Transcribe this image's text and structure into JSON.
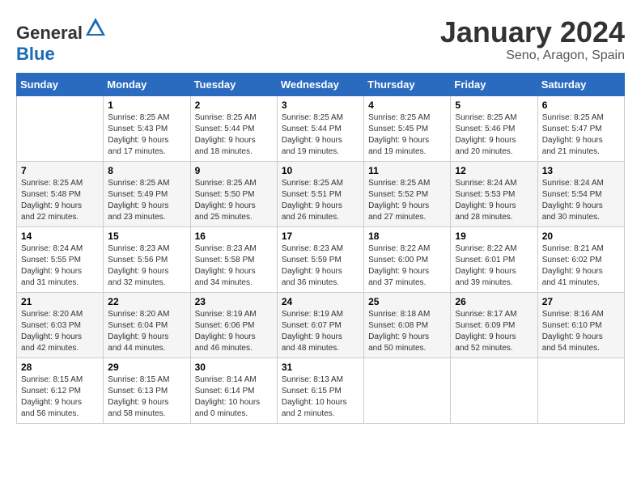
{
  "header": {
    "logo_general": "General",
    "logo_blue": "Blue",
    "title": "January 2024",
    "subtitle": "Seno, Aragon, Spain"
  },
  "weekdays": [
    "Sunday",
    "Monday",
    "Tuesday",
    "Wednesday",
    "Thursday",
    "Friday",
    "Saturday"
  ],
  "weeks": [
    [
      {
        "day": "",
        "info": ""
      },
      {
        "day": "1",
        "info": "Sunrise: 8:25 AM\nSunset: 5:43 PM\nDaylight: 9 hours\nand 17 minutes."
      },
      {
        "day": "2",
        "info": "Sunrise: 8:25 AM\nSunset: 5:44 PM\nDaylight: 9 hours\nand 18 minutes."
      },
      {
        "day": "3",
        "info": "Sunrise: 8:25 AM\nSunset: 5:44 PM\nDaylight: 9 hours\nand 19 minutes."
      },
      {
        "day": "4",
        "info": "Sunrise: 8:25 AM\nSunset: 5:45 PM\nDaylight: 9 hours\nand 19 minutes."
      },
      {
        "day": "5",
        "info": "Sunrise: 8:25 AM\nSunset: 5:46 PM\nDaylight: 9 hours\nand 20 minutes."
      },
      {
        "day": "6",
        "info": "Sunrise: 8:25 AM\nSunset: 5:47 PM\nDaylight: 9 hours\nand 21 minutes."
      }
    ],
    [
      {
        "day": "7",
        "info": "Sunrise: 8:25 AM\nSunset: 5:48 PM\nDaylight: 9 hours\nand 22 minutes."
      },
      {
        "day": "8",
        "info": "Sunrise: 8:25 AM\nSunset: 5:49 PM\nDaylight: 9 hours\nand 23 minutes."
      },
      {
        "day": "9",
        "info": "Sunrise: 8:25 AM\nSunset: 5:50 PM\nDaylight: 9 hours\nand 25 minutes."
      },
      {
        "day": "10",
        "info": "Sunrise: 8:25 AM\nSunset: 5:51 PM\nDaylight: 9 hours\nand 26 minutes."
      },
      {
        "day": "11",
        "info": "Sunrise: 8:25 AM\nSunset: 5:52 PM\nDaylight: 9 hours\nand 27 minutes."
      },
      {
        "day": "12",
        "info": "Sunrise: 8:24 AM\nSunset: 5:53 PM\nDaylight: 9 hours\nand 28 minutes."
      },
      {
        "day": "13",
        "info": "Sunrise: 8:24 AM\nSunset: 5:54 PM\nDaylight: 9 hours\nand 30 minutes."
      }
    ],
    [
      {
        "day": "14",
        "info": "Sunrise: 8:24 AM\nSunset: 5:55 PM\nDaylight: 9 hours\nand 31 minutes."
      },
      {
        "day": "15",
        "info": "Sunrise: 8:23 AM\nSunset: 5:56 PM\nDaylight: 9 hours\nand 32 minutes."
      },
      {
        "day": "16",
        "info": "Sunrise: 8:23 AM\nSunset: 5:58 PM\nDaylight: 9 hours\nand 34 minutes."
      },
      {
        "day": "17",
        "info": "Sunrise: 8:23 AM\nSunset: 5:59 PM\nDaylight: 9 hours\nand 36 minutes."
      },
      {
        "day": "18",
        "info": "Sunrise: 8:22 AM\nSunset: 6:00 PM\nDaylight: 9 hours\nand 37 minutes."
      },
      {
        "day": "19",
        "info": "Sunrise: 8:22 AM\nSunset: 6:01 PM\nDaylight: 9 hours\nand 39 minutes."
      },
      {
        "day": "20",
        "info": "Sunrise: 8:21 AM\nSunset: 6:02 PM\nDaylight: 9 hours\nand 41 minutes."
      }
    ],
    [
      {
        "day": "21",
        "info": "Sunrise: 8:20 AM\nSunset: 6:03 PM\nDaylight: 9 hours\nand 42 minutes."
      },
      {
        "day": "22",
        "info": "Sunrise: 8:20 AM\nSunset: 6:04 PM\nDaylight: 9 hours\nand 44 minutes."
      },
      {
        "day": "23",
        "info": "Sunrise: 8:19 AM\nSunset: 6:06 PM\nDaylight: 9 hours\nand 46 minutes."
      },
      {
        "day": "24",
        "info": "Sunrise: 8:19 AM\nSunset: 6:07 PM\nDaylight: 9 hours\nand 48 minutes."
      },
      {
        "day": "25",
        "info": "Sunrise: 8:18 AM\nSunset: 6:08 PM\nDaylight: 9 hours\nand 50 minutes."
      },
      {
        "day": "26",
        "info": "Sunrise: 8:17 AM\nSunset: 6:09 PM\nDaylight: 9 hours\nand 52 minutes."
      },
      {
        "day": "27",
        "info": "Sunrise: 8:16 AM\nSunset: 6:10 PM\nDaylight: 9 hours\nand 54 minutes."
      }
    ],
    [
      {
        "day": "28",
        "info": "Sunrise: 8:15 AM\nSunset: 6:12 PM\nDaylight: 9 hours\nand 56 minutes."
      },
      {
        "day": "29",
        "info": "Sunrise: 8:15 AM\nSunset: 6:13 PM\nDaylight: 9 hours\nand 58 minutes."
      },
      {
        "day": "30",
        "info": "Sunrise: 8:14 AM\nSunset: 6:14 PM\nDaylight: 10 hours\nand 0 minutes."
      },
      {
        "day": "31",
        "info": "Sunrise: 8:13 AM\nSunset: 6:15 PM\nDaylight: 10 hours\nand 2 minutes."
      },
      {
        "day": "",
        "info": ""
      },
      {
        "day": "",
        "info": ""
      },
      {
        "day": "",
        "info": ""
      }
    ]
  ]
}
